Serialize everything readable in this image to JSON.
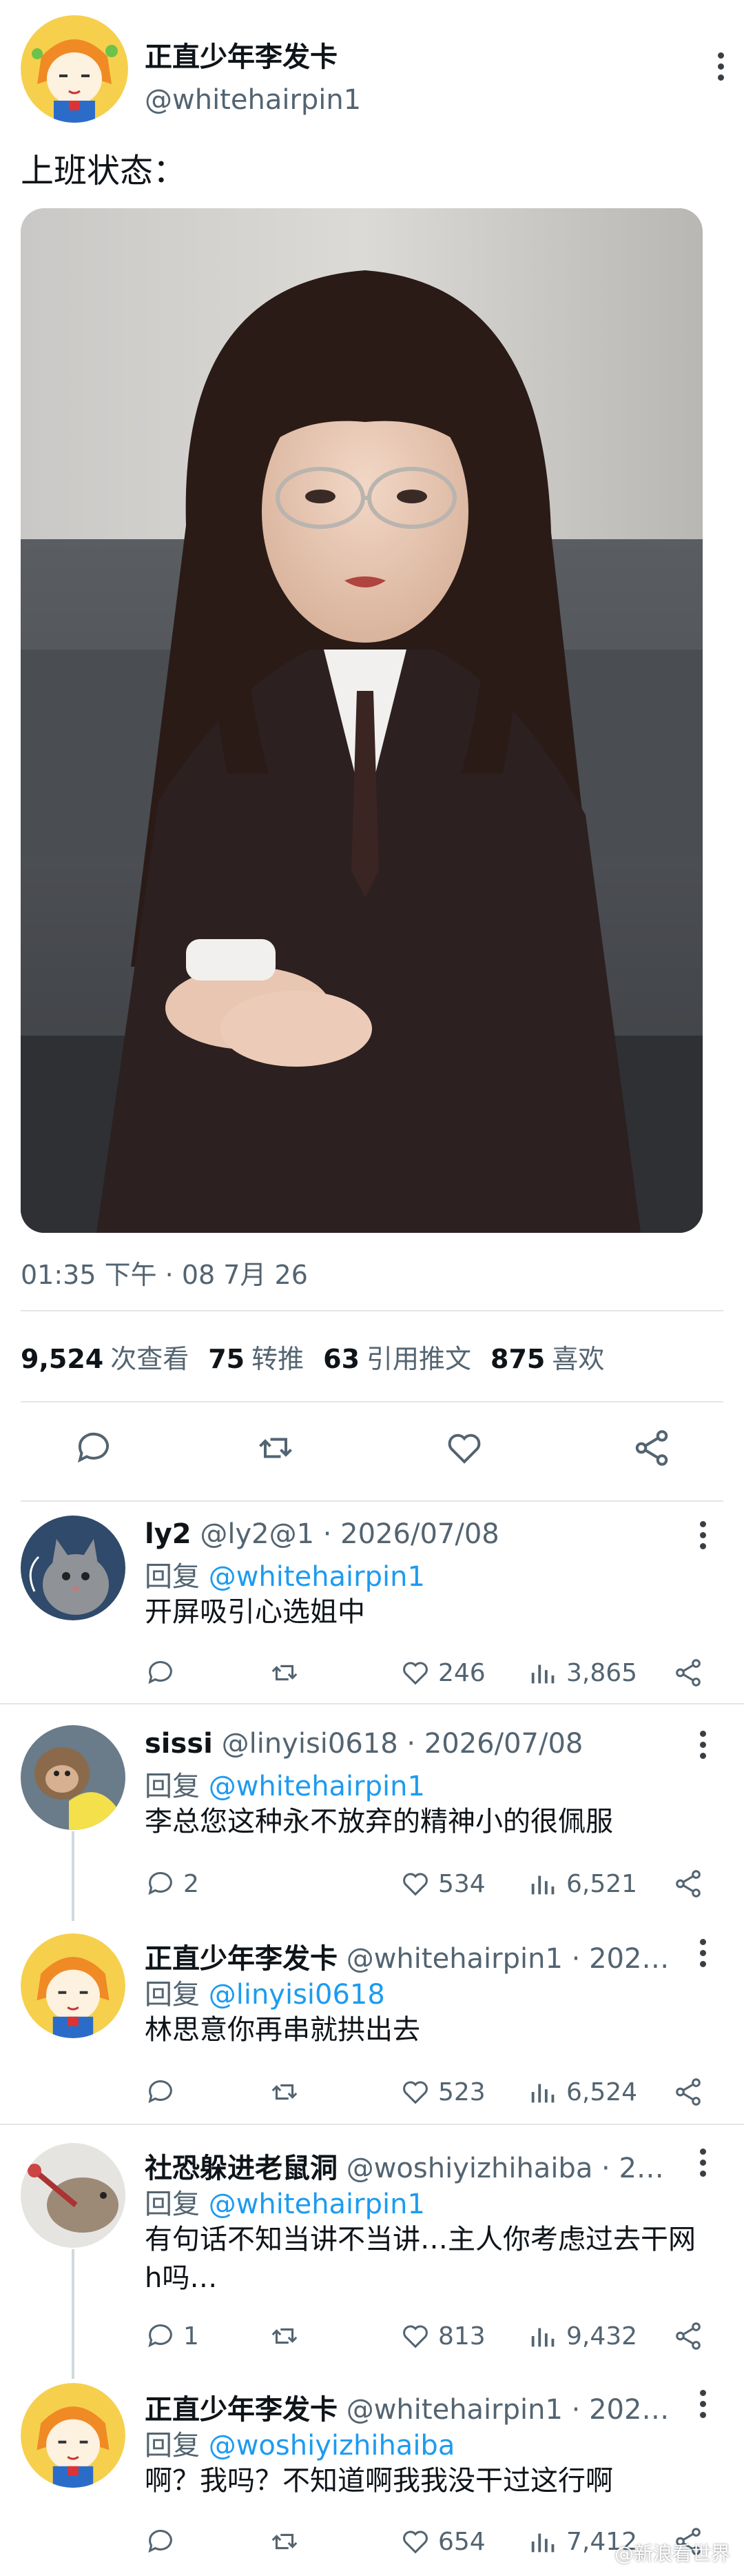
{
  "post": {
    "author_name": "正直少年李发卡",
    "author_handle": "@whitehairpin1",
    "text": "上班状态：",
    "timestamp": "01:35 下午 · 08 7月 26",
    "stats": {
      "views_count": "9,524",
      "views_label": "次查看",
      "retweets_count": "75",
      "retweets_label": "转推",
      "quotes_count": "63",
      "quotes_label": "引用推文",
      "likes_count": "875",
      "likes_label": "喜欢"
    }
  },
  "replies": [
    {
      "name": "ly2",
      "meta": "@ly2@1 · 2026/07/08",
      "reply_label": "回复",
      "reply_to": "@whitehairpin1",
      "text": "开屏吸引心选姐中",
      "replies": "",
      "likes": "246",
      "views": "3,865"
    },
    {
      "name": "sissi",
      "meta": "@linyisi0618 · 2026/07/08",
      "reply_label": "回复",
      "reply_to": "@whitehairpin1",
      "text": "李总您这种永不放弃的精神小的很佩服",
      "replies": "2",
      "likes": "534",
      "views": "6,521"
    },
    {
      "name": "正直少年李发卡",
      "meta": "@whitehairpin1 · 202…",
      "reply_label": "回复",
      "reply_to": "@linyisi0618",
      "text": "林思意你再串就拱出去",
      "replies": "",
      "likes": "523",
      "views": "6,524"
    },
    {
      "name": "社恐躲进老鼠洞",
      "meta": "@woshiyizhihaiba · 2…",
      "reply_label": "回复",
      "reply_to": "@whitehairpin1",
      "text": "有句话不知当讲不当讲…主人你考虑过去干网h吗…",
      "replies": "1",
      "likes": "813",
      "views": "9,432"
    },
    {
      "name": "正直少年李发卡",
      "meta": "@whitehairpin1 · 202…",
      "reply_label": "回复",
      "reply_to": "@woshiyizhihaiba",
      "text": "啊？我吗？不知道啊我我没干过这行啊",
      "replies": "",
      "likes": "654",
      "views": "7,412"
    }
  ],
  "watermark": "@新浪看世界",
  "colors": {
    "link": "#1d9bf0",
    "secondary": "#536471",
    "primary": "#0f1419",
    "divider": "#e3e6e9"
  }
}
